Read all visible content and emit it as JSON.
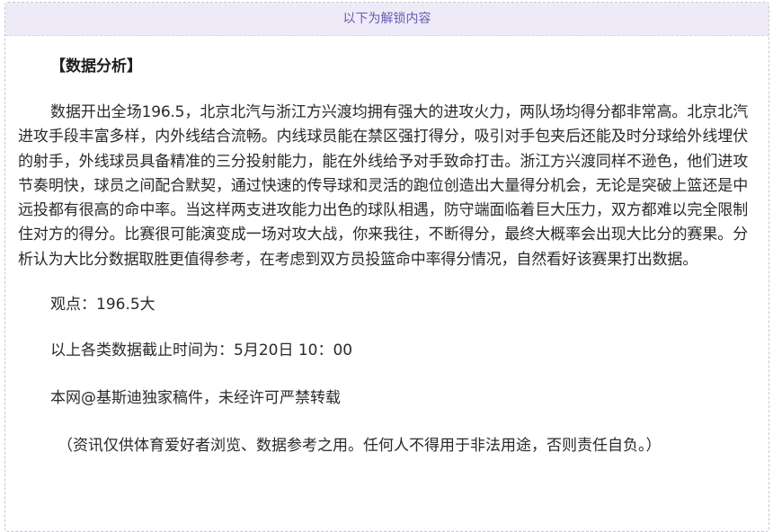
{
  "unlock": {
    "header_label": "以下为解锁内容"
  },
  "article": {
    "section_title": "【数据分析】",
    "analysis_text": "数据开出全场196.5，北京北汽与浙江方兴渡均拥有强大的进攻火力，两队场均得分都非常高。北京北汽进攻手段丰富多样，内外线结合流畅。内线球员能在禁区强打得分，吸引对手包夹后还能及时分球给外线埋伏的射手，外线球员具备精准的三分投射能力，能在外线给予对手致命打击。浙江方兴渡同样不逊色，他们进攻节奏明快，球员之间配合默契，通过快速的传导球和灵活的跑位创造出大量得分机会，无论是突破上篮还是中远投都有很高的命中率。当这样两支进攻能力出色的球队相遇，防守端面临着巨大压力，双方都难以完全限制住对方的得分。比赛很可能演变成一场对攻大战，你来我往，不断得分，最终大概率会出现大比分的赛果。分析认为大比分数据取胜更值得参考，在考虑到双方员投篮命中率得分情况，自然看好该赛果打出数据。",
    "viewpoint": "观点：196.5大",
    "deadline": "以上各类数据截止时间为：5月20日 10：00",
    "copyright": "本网@基斯迪独家稿件，未经许可严禁转载",
    "disclaimer": "（资讯仅供体育爱好者浏览、数据参考之用。任何人不得用于非法用途，否则责任自负。）"
  }
}
